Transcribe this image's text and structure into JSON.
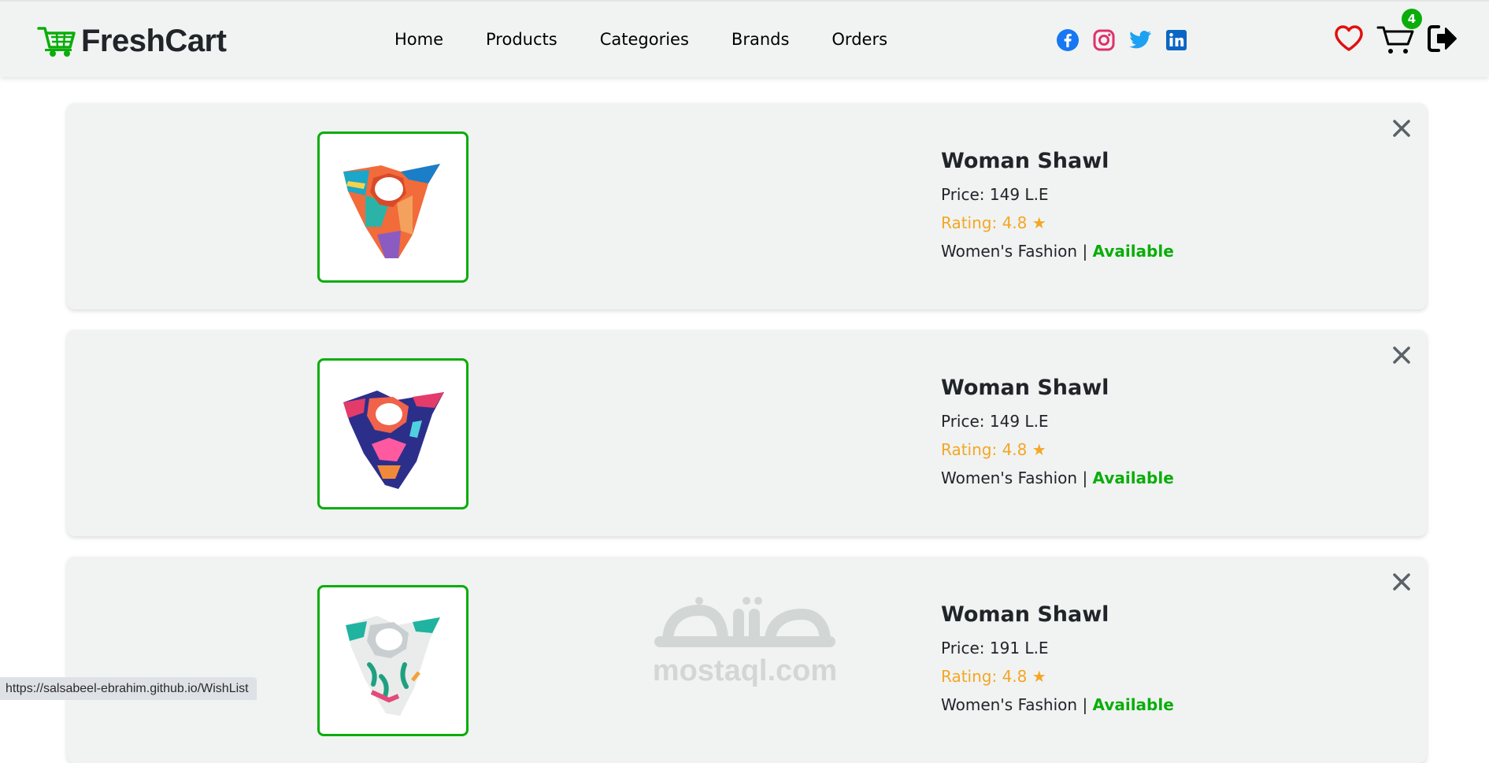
{
  "brand": {
    "name": "FreshCart",
    "color": "#0aad0a"
  },
  "nav": {
    "links": [
      "Home",
      "Products",
      "Categories",
      "Brands",
      "Orders"
    ]
  },
  "socials": [
    "facebook-icon",
    "instagram-icon",
    "twitter-icon",
    "linkedin-icon"
  ],
  "cart": {
    "count": "4"
  },
  "wishlist": {
    "items": [
      {
        "title": "Woman Shawl",
        "price_label": "Price:",
        "price": "149 L.E",
        "rating": "Rating: 4.8",
        "category": "Women's Fashion",
        "separator": "|",
        "status": "Available"
      },
      {
        "title": "Woman Shawl",
        "price_label": "Price:",
        "price": "149 L.E",
        "rating": "Rating: 4.8",
        "category": "Women's Fashion",
        "separator": "|",
        "status": "Available"
      },
      {
        "title": "Woman Shawl",
        "price_label": "Price:",
        "price": "191 L.E",
        "rating": "Rating: 4.8",
        "category": "Women's Fashion",
        "separator": "|",
        "status": "Available"
      }
    ]
  },
  "watermark": {
    "text": "mostaql.com"
  },
  "status_url": "https://salsabeel-ebrahim.github.io/WishList"
}
